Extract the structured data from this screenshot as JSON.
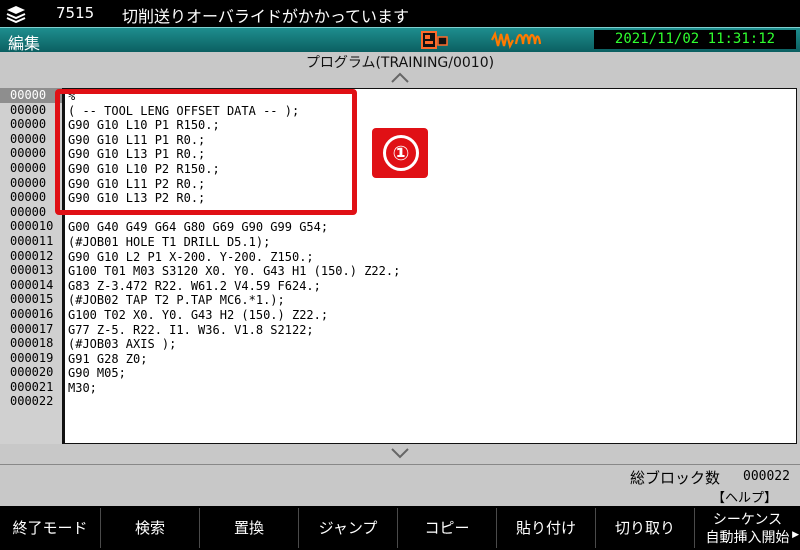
{
  "alarm": {
    "code": "7515",
    "message": "切削送りオーバライドがかかっています"
  },
  "status": {
    "mode": "編集",
    "datetime": "2021/11/02 11:31:12"
  },
  "program": {
    "title": "プログラム(TRAINING/0010)"
  },
  "line_numbers": [
    "00000",
    "00000",
    "00000",
    "00000",
    "00000",
    "00000",
    "00000",
    "00000",
    "00000",
    "000010",
    "000011",
    "000012",
    "000013",
    "000014",
    "000015",
    "000016",
    "000017",
    "000018",
    "000019",
    "000020",
    "000021",
    "000022"
  ],
  "code_lines": [
    "%",
    "( -- TOOL LENG OFFSET DATA -- );",
    "G90 G10 L10 P1 R150.;",
    "G90 G10 L11 P1 R0.;",
    "G90 G10 L13 P1 R0.;",
    "G90 G10 L10 P2 R150.;",
    "G90 G10 L11 P2 R0.;",
    "G90 G10 L13 P2 R0.;",
    "",
    "G00 G40 G49 G64 G80 G69 G90 G99 G54;",
    "(#JOB01 HOLE T1 DRILL D5.1);",
    "G90 G10 L2 P1 X-200. Y-200. Z150.;",
    "G100 T01 M03 S3120 X0. Y0. G43 H1 (150.) Z22.;",
    "G83 Z-3.472 R22. W61.2 V4.59 F624.;",
    "(#JOB02 TAP T2 P.TAP MC6.*1.);",
    "G100 T02 X0. Y0. G43 H2 (150.) Z22.;",
    "G77 Z-5. R22. I1. W36. V1.8 S2122;",
    "(#JOB03 AXIS );",
    "G91 G28 Z0;",
    "G90 M05;",
    "M30;",
    ""
  ],
  "annotation": {
    "badge": "①"
  },
  "info": {
    "block_count_label": "総ブロック数",
    "block_count": "000022",
    "help": "【ヘルプ】"
  },
  "softkeys": {
    "end_mode": "終了モード",
    "search": "検索",
    "replace": "置換",
    "jump": "ジャンプ",
    "copy": "コピー",
    "paste": "貼り付け",
    "cut": "切り取り",
    "sequence_line1": "シーケンス",
    "sequence_line2": "自動挿入開始"
  },
  "colors": {
    "alarm_bg": "#000000",
    "status_teal": "#0f6e70",
    "clock_text": "#2fff2f",
    "annotation_red": "#e01015"
  }
}
